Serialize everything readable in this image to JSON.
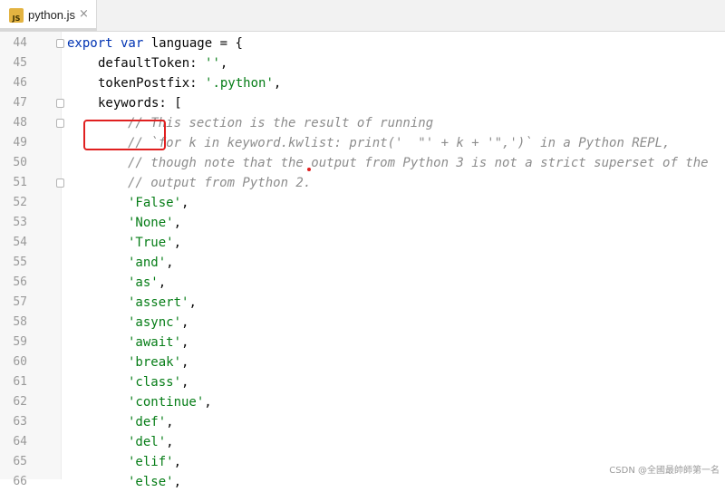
{
  "tab": {
    "icon_label": "JS",
    "label": "python.js",
    "close_glyph": "×"
  },
  "lines": [
    {
      "n": "44",
      "fold": true,
      "indent": 0,
      "parts": [
        {
          "t": "export var",
          "c": "kw"
        },
        {
          "t": " language = {",
          "c": "prop"
        }
      ]
    },
    {
      "n": "45",
      "fold": false,
      "indent": 1,
      "parts": [
        {
          "t": "defaultToken: ",
          "c": "prop"
        },
        {
          "t": "''",
          "c": "str"
        },
        {
          "t": ",",
          "c": "prop"
        }
      ]
    },
    {
      "n": "46",
      "fold": false,
      "indent": 1,
      "parts": [
        {
          "t": "tokenPostfix: ",
          "c": "prop"
        },
        {
          "t": "'.python'",
          "c": "str"
        },
        {
          "t": ",",
          "c": "prop"
        }
      ]
    },
    {
      "n": "47",
      "fold": true,
      "indent": 1,
      "parts": [
        {
          "t": "keywords: [",
          "c": "prop"
        }
      ]
    },
    {
      "n": "48",
      "fold": true,
      "indent": 2,
      "parts": [
        {
          "t": "// This section is the result of running",
          "c": "cm"
        }
      ]
    },
    {
      "n": "49",
      "fold": false,
      "indent": 2,
      "parts": [
        {
          "t": "// `for k in keyword.kwlist: print('  \"' + k + '\",')` in a Python REPL,",
          "c": "cm"
        }
      ]
    },
    {
      "n": "50",
      "fold": false,
      "indent": 2,
      "parts": [
        {
          "t": "// though note that the output from Python 3 is not a strict superset of the",
          "c": "cm"
        }
      ]
    },
    {
      "n": "51",
      "fold": true,
      "indent": 2,
      "parts": [
        {
          "t": "// output from Python 2.",
          "c": "cm"
        }
      ]
    },
    {
      "n": "52",
      "fold": false,
      "indent": 2,
      "parts": [
        {
          "t": "'False'",
          "c": "str"
        },
        {
          "t": ",",
          "c": "prop"
        }
      ]
    },
    {
      "n": "53",
      "fold": false,
      "indent": 2,
      "parts": [
        {
          "t": "'None'",
          "c": "str"
        },
        {
          "t": ",",
          "c": "prop"
        }
      ]
    },
    {
      "n": "54",
      "fold": false,
      "indent": 2,
      "parts": [
        {
          "t": "'True'",
          "c": "str"
        },
        {
          "t": ",",
          "c": "prop"
        }
      ]
    },
    {
      "n": "55",
      "fold": false,
      "indent": 2,
      "parts": [
        {
          "t": "'and'",
          "c": "str"
        },
        {
          "t": ",",
          "c": "prop"
        }
      ]
    },
    {
      "n": "56",
      "fold": false,
      "indent": 2,
      "parts": [
        {
          "t": "'as'",
          "c": "str"
        },
        {
          "t": ",",
          "c": "prop"
        }
      ]
    },
    {
      "n": "57",
      "fold": false,
      "indent": 2,
      "parts": [
        {
          "t": "'assert'",
          "c": "str"
        },
        {
          "t": ",",
          "c": "prop"
        }
      ]
    },
    {
      "n": "58",
      "fold": false,
      "indent": 2,
      "parts": [
        {
          "t": "'async'",
          "c": "str"
        },
        {
          "t": ",",
          "c": "prop"
        }
      ]
    },
    {
      "n": "59",
      "fold": false,
      "indent": 2,
      "parts": [
        {
          "t": "'await'",
          "c": "str"
        },
        {
          "t": ",",
          "c": "prop"
        }
      ]
    },
    {
      "n": "60",
      "fold": false,
      "indent": 2,
      "parts": [
        {
          "t": "'break'",
          "c": "str"
        },
        {
          "t": ",",
          "c": "prop"
        }
      ]
    },
    {
      "n": "61",
      "fold": false,
      "indent": 2,
      "parts": [
        {
          "t": "'class'",
          "c": "str"
        },
        {
          "t": ",",
          "c": "prop"
        }
      ]
    },
    {
      "n": "62",
      "fold": false,
      "indent": 2,
      "parts": [
        {
          "t": "'continue'",
          "c": "str"
        },
        {
          "t": ",",
          "c": "prop"
        }
      ]
    },
    {
      "n": "63",
      "fold": false,
      "indent": 2,
      "parts": [
        {
          "t": "'def'",
          "c": "str"
        },
        {
          "t": ",",
          "c": "prop"
        }
      ]
    },
    {
      "n": "64",
      "fold": false,
      "indent": 2,
      "parts": [
        {
          "t": "'del'",
          "c": "str"
        },
        {
          "t": ",",
          "c": "prop"
        }
      ]
    },
    {
      "n": "65",
      "fold": false,
      "indent": 2,
      "parts": [
        {
          "t": "'elif'",
          "c": "str"
        },
        {
          "t": ",",
          "c": "prop"
        }
      ]
    },
    {
      "n": "66",
      "fold": false,
      "indent": 2,
      "parts": [
        {
          "t": "'else'",
          "c": "str"
        },
        {
          "t": ",",
          "c": "prop"
        }
      ]
    }
  ],
  "watermark": "CSDN @全國最帥師第一名",
  "colors": {
    "keyword": "#0033b3",
    "string": "#067d17",
    "comment": "#8c8c8c",
    "highlight": "#e02020"
  }
}
